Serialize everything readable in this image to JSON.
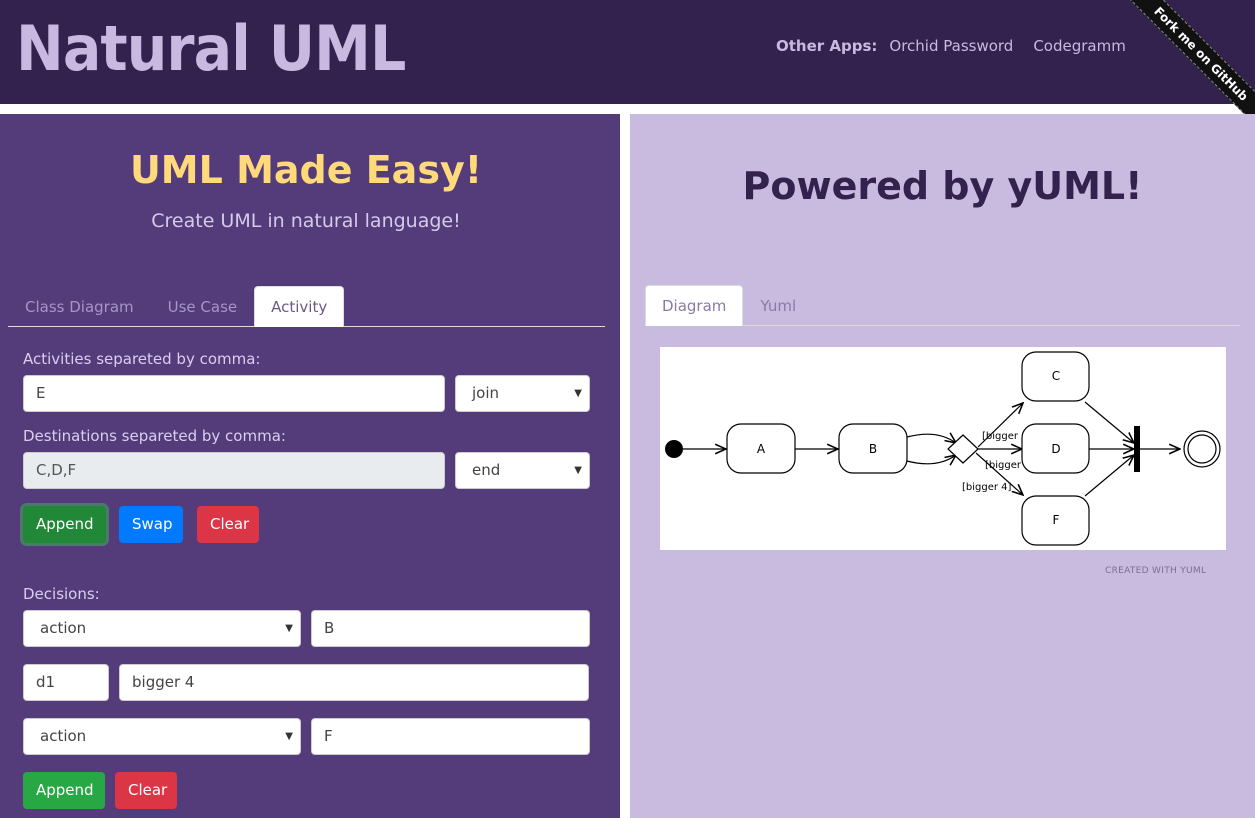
{
  "header": {
    "logo": "Natural UML",
    "other_apps_label": "Other Apps:",
    "links": [
      "Orchid Password",
      "Codegramm"
    ],
    "ribbon": "Fork me on GitHub"
  },
  "left": {
    "title": "UML Made Easy!",
    "subtitle": "Create UML in natural language!",
    "tabs": [
      "Class Diagram",
      "Use Case",
      "Activity"
    ],
    "activities_label": "Activities separeted by comma:",
    "activities_value": "E",
    "activities_select": "join",
    "destinations_label": "Destinations separeted by comma:",
    "destinations_value": "C,D,F",
    "destinations_select": "end",
    "buttons": {
      "append": "Append",
      "swap": "Swap",
      "clear": "Clear"
    },
    "decisions_label": "Decisions:",
    "decision1_select": "action",
    "decision1_value": "B",
    "decision_id": "d1",
    "decision_condition": "bigger 4",
    "decision2_select": "action",
    "decision2_value": "F",
    "bottom_buttons": {
      "append": "Append",
      "clear": "Clear"
    }
  },
  "right": {
    "title": "Powered by yUML!",
    "tabs": [
      "Diagram",
      "Yuml"
    ],
    "credit": "CREATED WITH YUML",
    "diagram": {
      "nodes": [
        "A",
        "B",
        "C",
        "D",
        "F"
      ],
      "guards": [
        "[bigger",
        "[bigger 3]",
        "[bigger 4]"
      ]
    }
  },
  "colors": {
    "header_bg": "#33224d",
    "left_bg": "#543c7a",
    "right_bg": "#c9bbe0",
    "accent_yellow": "#ffd97a"
  }
}
